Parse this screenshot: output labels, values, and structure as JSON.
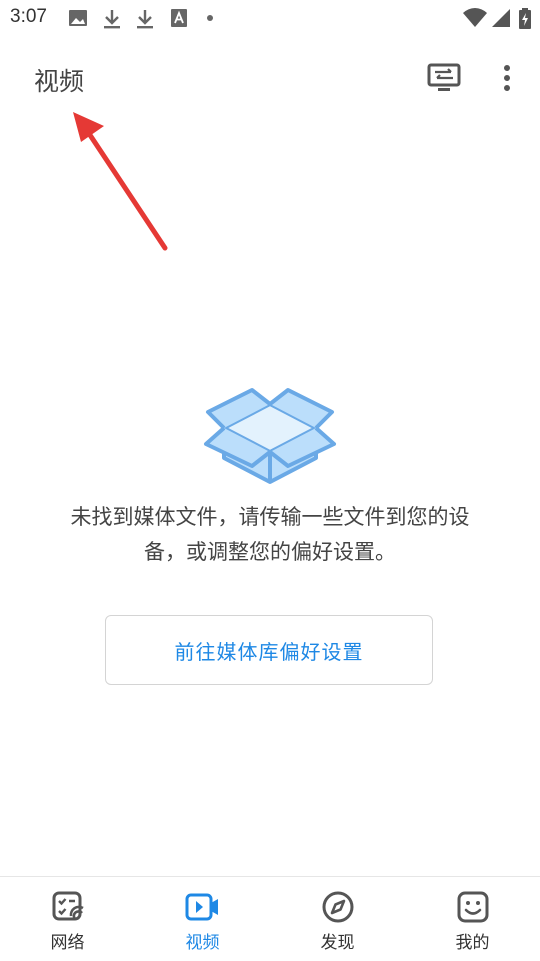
{
  "status_bar": {
    "time": "3:07"
  },
  "app_bar": {
    "title": "视频",
    "cast_icon": "cast-icon",
    "more_icon": "more-vert-icon"
  },
  "empty_state": {
    "illustration": "open-box-icon",
    "message_line1": "未找到媒体文件，请传输一些文件到您的设",
    "message_line2": "备，或调整您的偏好设置。",
    "button_label": "前往媒体库偏好设置"
  },
  "bottom_nav": {
    "items": [
      {
        "label": "网络",
        "icon": "network-icon",
        "active": false
      },
      {
        "label": "视频",
        "icon": "video-icon",
        "active": true
      },
      {
        "label": "发现",
        "icon": "compass-icon",
        "active": false
      },
      {
        "label": "我的",
        "icon": "smile-icon",
        "active": false
      }
    ]
  },
  "colors": {
    "accent": "#1e88e5",
    "annotation_arrow": "#e53935",
    "box_fill": "#bbdefb",
    "box_stroke": "#6aa9e6"
  }
}
